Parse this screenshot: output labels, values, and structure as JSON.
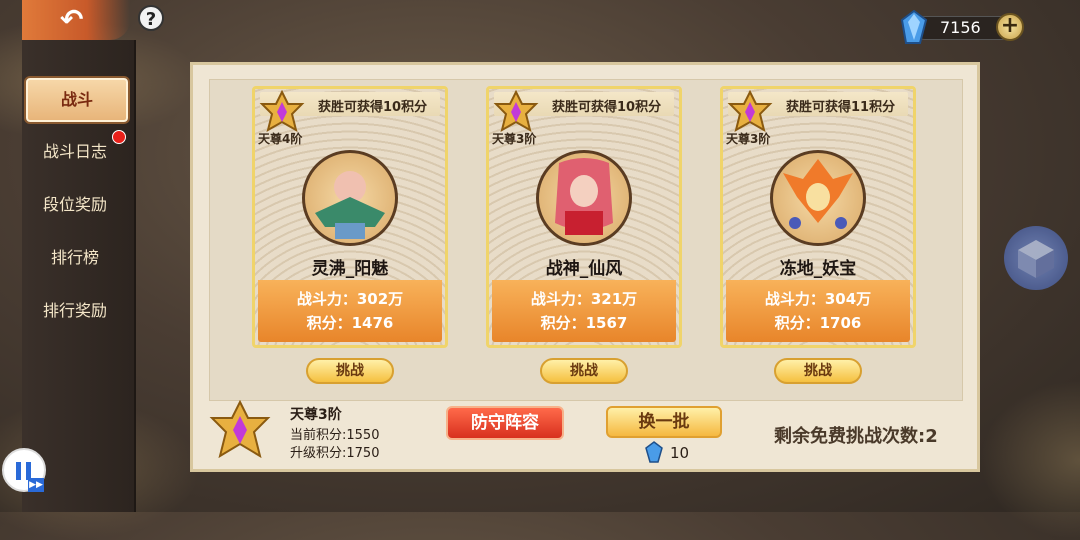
{
  "topbar": {
    "help_label": "?",
    "currency_value": "7156",
    "plus_label": "+"
  },
  "sidebar": {
    "items": [
      {
        "label": "战斗",
        "active": true
      },
      {
        "label": "战斗日志",
        "badge": true
      },
      {
        "label": "段位奖励"
      },
      {
        "label": "排行榜"
      },
      {
        "label": "排行奖励"
      }
    ]
  },
  "cards": [
    {
      "win_text": "获胜可获得10积分",
      "rank": "天尊4阶",
      "name": "灵沸_阳魅",
      "power": "战斗力：302万",
      "score": "积分：1476",
      "challenge": "挑战"
    },
    {
      "win_text": "获胜可获得10积分",
      "rank": "天尊3阶",
      "name": "战神_仙风",
      "power": "战斗力：321万",
      "score": "积分：1567",
      "challenge": "挑战"
    },
    {
      "win_text": "获胜可获得11积分",
      "rank": "天尊3阶",
      "name": "冻地_妖宝",
      "power": "战斗力：304万",
      "score": "积分：1706",
      "challenge": "挑战"
    }
  ],
  "footer": {
    "my_rank": "天尊3阶",
    "current_score": "当前积分:1550",
    "upgrade_score": "升级积分:1750",
    "defense_label": "防守阵容",
    "refresh_label": "换一批",
    "refresh_cost": "10",
    "free_left": "剩余免费挑战次数:2"
  },
  "colors": {
    "accent_orange": "#e8852a",
    "gold": "#f0d46a",
    "red_button": "#d8301e"
  }
}
